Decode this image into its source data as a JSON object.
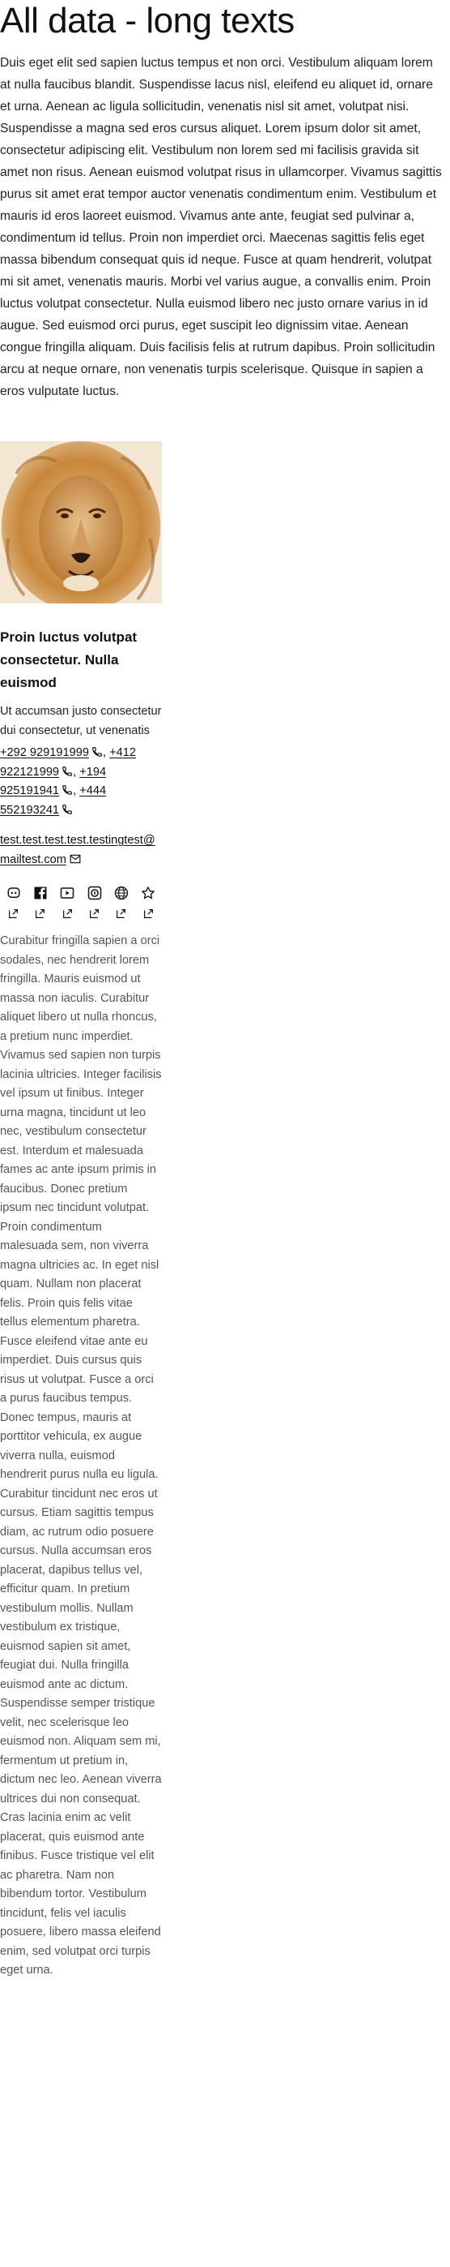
{
  "page": {
    "title": "All data - long texts",
    "intro": "Duis eget elit sed sapien luctus tempus et non orci. Vestibulum aliquam lorem at nulla faucibus blandit. Suspendisse lacus nisl, eleifend eu aliquet id, ornare et urna. Aenean ac ligula sollicitudin, venenatis nisl sit amet, volutpat nisi. Suspendisse a magna sed eros cursus aliquet. Lorem ipsum dolor sit amet, consectetur adipiscing elit. Vestibulum non lorem sed mi facilisis gravida sit amet non risus. Aenean euismod volutpat risus in ullamcorper. Vivamus sagittis purus sit amet erat tempor auctor venenatis condimentum enim. Vestibulum et mauris id eros laoreet euismod. Vivamus ante ante, feugiat sed pulvinar a, condimentum id tellus. Proin non imperdiet orci. Maecenas sagittis felis eget massa bibendum consequat quis id neque. Fusce at quam hendrerit, volutpat mi sit amet, venenatis mauris. Morbi vel varius augue, a convallis enim. Proin luctus volutpat consectetur. Nulla euismod libero nec justo ornare varius in id augue. Sed euismod orci purus, eget suscipit leo dignissim vitae. Aenean congue fringilla aliquam. Duis facilisis felis at rutrum dapibus. Proin sollicitudin arcu at neque ornare, non venenatis turpis scelerisque. Quisque in sapien a eros vulputate luctus."
  },
  "card": {
    "image_icon": "lion-photo",
    "title": "Proin luctus volutpat consectetur. Nulla euismod",
    "description": "Ut accumsan justo consectetur dui consectetur, ut venenatis",
    "phones": [
      "+292 929191999",
      "+412 922121999",
      "+194 925191941",
      "+444 552193241"
    ],
    "phone_separator": ",",
    "email": "test.test.test.test.testingtest@mailtest.com",
    "socials": [
      {
        "icon": "discord-icon"
      },
      {
        "icon": "facebook-icon"
      },
      {
        "icon": "youtube-icon"
      },
      {
        "icon": "skype-icon"
      },
      {
        "icon": "globe-icon"
      },
      {
        "icon": "star-icon"
      }
    ],
    "body": "Curabitur fringilla sapien a orci sodales, nec hendrerit lorem fringilla. Mauris euismod ut massa non iaculis. Curabitur aliquet libero ut nulla rhoncus, a pretium nunc imperdiet. Vivamus sed sapien non turpis lacinia ultricies. Integer facilisis vel ipsum ut finibus. Integer urna magna, tincidunt ut leo nec, vestibulum consectetur est. Interdum et malesuada fames ac ante ipsum primis in faucibus. Donec pretium ipsum nec tincidunt volutpat. Proin condimentum malesuada sem, non viverra magna ultricies ac. In eget nisl quam. Nullam non placerat felis. Proin quis felis vitae tellus elementum pharetra. Fusce eleifend vitae ante eu imperdiet. Duis cursus quis risus ut volutpat. Fusce a orci a purus faucibus tempus. Donec tempus, mauris at porttitor vehicula, ex augue viverra nulla, euismod hendrerit purus nulla eu ligula. Curabitur tincidunt nec eros ut cursus. Etiam sagittis tempus diam, ac rutrum odio posuere cursus. Nulla accumsan eros placerat, dapibus tellus vel, efficitur quam. In pretium vestibulum mollis. Nullam vestibulum ex tristique, euismod sapien sit amet, feugiat dui. Nulla fringilla euismod ante ac dictum. Suspendisse semper tristique velit, nec scelerisque leo euismod non. Aliquam sem mi, fermentum ut pretium in, dictum nec leo. Aenean viverra ultrices dui non consequat. Cras lacinia enim ac velit placerat, quis euismod ante finibus. Fusce tristique vel elit ac pharetra. Nam non bibendum tortor. Vestibulum tincidunt, felis vel iaculis posuere, libero massa eleifend enim, sed volutpat orci turpis eget urna."
  },
  "colors": {
    "text": "#111111",
    "body_text": "#555555",
    "lion_mane": "#c8873a",
    "lion_face": "#d9a869",
    "background": "#ffffff"
  }
}
